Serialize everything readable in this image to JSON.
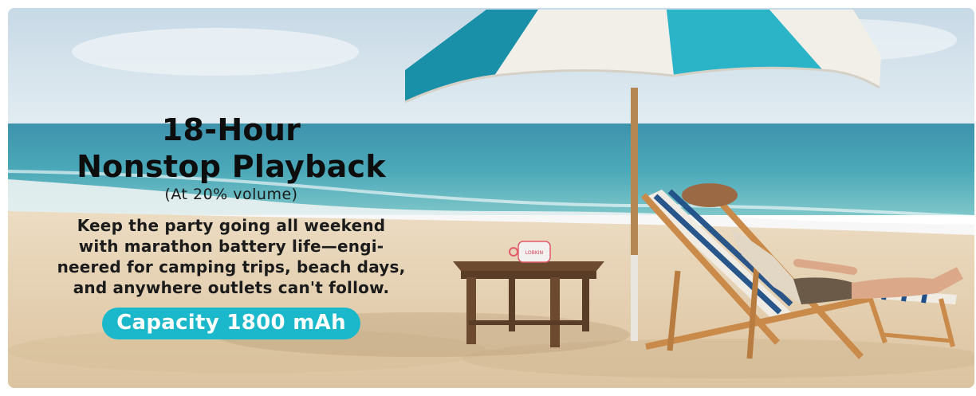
{
  "banner": {
    "headline_line1": "18-Hour",
    "headline_line2": "Nonstop Playback",
    "note": "(At 20% volume)",
    "body_lines": [
      "Keep the party going all weekend",
      "with marathon battery life—engi-",
      "neered for camping trips, beach days,",
      "and anywhere outlets can't follow."
    ],
    "capacity_label": "Capacity 1800 mAh",
    "device_logo": "LOBKIN"
  },
  "colors": {
    "accent": "#1bb8cb",
    "umbrella_teal": "#1a8fa8",
    "umbrella_white": "#f2efe8",
    "sand": "#e8d6bb",
    "sea": "#3f9fb4"
  }
}
